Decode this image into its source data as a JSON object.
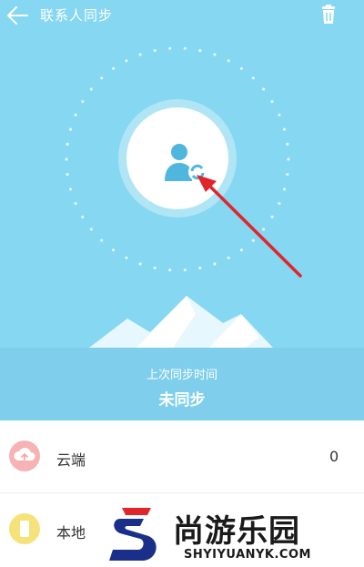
{
  "header": {
    "title": "联系人同步",
    "back_icon": "back-arrow-icon",
    "trash_icon": "trash-icon"
  },
  "hero": {
    "avatar_icon": "contact-sync-icon",
    "last_sync_label": "上次同步时间",
    "last_sync_value": "未同步"
  },
  "list": {
    "items": [
      {
        "label": "云端",
        "count": "0",
        "icon": "cloud-icon",
        "icon_color": "#f7a7a7"
      },
      {
        "label": "本地",
        "count": "",
        "icon": "phone-icon",
        "icon_color": "#f5e37a"
      }
    ]
  },
  "watermark": {
    "brand": "尚游乐园",
    "url": "SHYIYUANYK.COM"
  },
  "colors": {
    "hero_bg": "#86d7f1",
    "accent_blue": "#4fb6dd",
    "annotation_red": "#e0262a"
  }
}
